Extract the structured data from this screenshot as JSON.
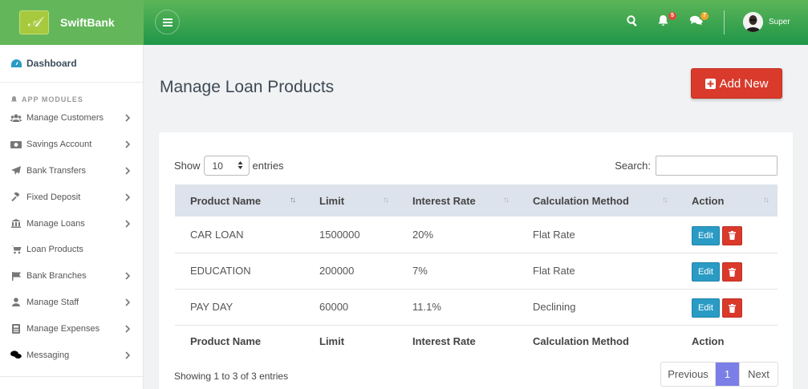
{
  "app": {
    "name": "SwiftBank",
    "logo_text": "𝒜"
  },
  "header": {
    "notifications_count": "5",
    "messages_count": "7",
    "user_name": "Super"
  },
  "sidebar": {
    "dashboard_label": "Dashboard",
    "section_label": "APP MODULES",
    "items": [
      {
        "label": "Manage Customers",
        "icon": "users-icon",
        "has_children": true
      },
      {
        "label": "Savings Account",
        "icon": "money-icon",
        "has_children": true
      },
      {
        "label": "Bank Transfers",
        "icon": "paper-plane-icon",
        "has_children": true
      },
      {
        "label": "Fixed Deposit",
        "icon": "gavel-icon",
        "has_children": true
      },
      {
        "label": "Manage Loans",
        "icon": "bank-icon",
        "has_children": true
      },
      {
        "label": "Loan Products",
        "icon": "cart-icon",
        "has_children": false
      },
      {
        "label": "Bank Branches",
        "icon": "flag-icon",
        "has_children": true
      },
      {
        "label": "Manage Staff",
        "icon": "user-icon",
        "has_children": true
      },
      {
        "label": "Manage Expenses",
        "icon": "calculator-icon",
        "has_children": true
      },
      {
        "label": "Messaging",
        "icon": "comments-icon",
        "has_children": true
      }
    ]
  },
  "page": {
    "title": "Manage Loan Products",
    "add_button_label": "Add New"
  },
  "table": {
    "show_label": "Show",
    "entries_label": "entries",
    "page_length": "10",
    "search_label": "Search:",
    "search_value": "",
    "columns": [
      "Product Name",
      "Limit",
      "Interest Rate",
      "Calculation Method",
      "Action"
    ],
    "rows": [
      {
        "product_name": "CAR LOAN",
        "limit": "1500000",
        "interest_rate": "20%",
        "calculation_method": "Flat Rate"
      },
      {
        "product_name": "EDUCATION",
        "limit": "200000",
        "interest_rate": "7%",
        "calculation_method": "Flat Rate"
      },
      {
        "product_name": "PAY DAY",
        "limit": "60000",
        "interest_rate": "11.1%",
        "calculation_method": "Declining"
      }
    ],
    "edit_label": "Edit",
    "info": "Showing 1 to 3 of 3 entries",
    "pagination": {
      "previous": "Previous",
      "current": "1",
      "next": "Next"
    }
  },
  "colors": {
    "header_green": "#1f9648",
    "accent_blue": "#2a9bc4",
    "danger_red": "#d93a2b",
    "active_page": "#7b7ee6"
  }
}
